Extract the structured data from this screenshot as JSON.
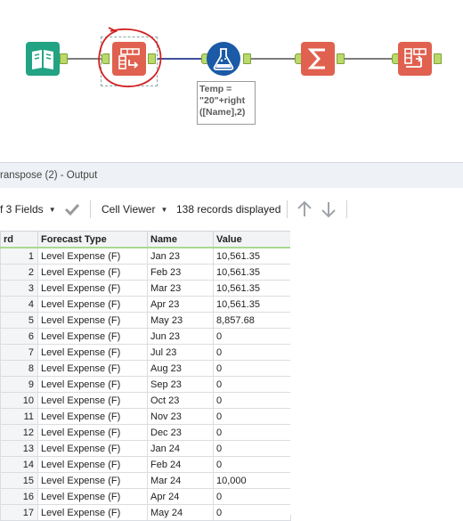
{
  "workflow": {
    "annotation_text": "Temp =\n\"20\"+right\n([Name],2)",
    "tools": [
      {
        "name": "input-data-tool",
        "color": "#22a384"
      },
      {
        "name": "transpose-tool",
        "color": "#e0614f",
        "selected": true
      },
      {
        "name": "formula-tool",
        "color": "#1a5aa6"
      },
      {
        "name": "summarize-tool",
        "color": "#e0614f"
      },
      {
        "name": "crosstab-tool",
        "color": "#e0614f"
      }
    ]
  },
  "results": {
    "title": "ranspose (2) - Output",
    "fields_selector": "f 3 Fields",
    "viewer_selector": "Cell Viewer",
    "records_displayed": "138 records displayed",
    "columns": [
      "rd",
      "Forecast Type",
      "Name",
      "Value"
    ],
    "rows": [
      [
        "1",
        "Level Expense (F)",
        "Jan 23",
        "10,561.35"
      ],
      [
        "2",
        "Level Expense (F)",
        "Feb 23",
        "10,561.35"
      ],
      [
        "3",
        "Level Expense (F)",
        "Mar 23",
        "10,561.35"
      ],
      [
        "4",
        "Level Expense (F)",
        "Apr 23",
        "10,561.35"
      ],
      [
        "5",
        "Level Expense (F)",
        "May 23",
        "8,857.68"
      ],
      [
        "6",
        "Level Expense (F)",
        "Jun 23",
        "0"
      ],
      [
        "7",
        "Level Expense (F)",
        "Jul 23",
        "0"
      ],
      [
        "8",
        "Level Expense (F)",
        "Aug 23",
        "0"
      ],
      [
        "9",
        "Level Expense (F)",
        "Sep 23",
        "0"
      ],
      [
        "10",
        "Level Expense (F)",
        "Oct 23",
        "0"
      ],
      [
        "11",
        "Level Expense (F)",
        "Nov 23",
        "0"
      ],
      [
        "12",
        "Level Expense (F)",
        "Dec 23",
        "0"
      ],
      [
        "13",
        "Level Expense (F)",
        "Jan 24",
        "0"
      ],
      [
        "14",
        "Level Expense (F)",
        "Feb 24",
        "0"
      ],
      [
        "15",
        "Level Expense (F)",
        "Mar 24",
        "10,000"
      ],
      [
        "16",
        "Level Expense (F)",
        "Apr 24",
        "0"
      ],
      [
        "17",
        "Level Expense (F)",
        "May 24",
        "0"
      ]
    ]
  }
}
